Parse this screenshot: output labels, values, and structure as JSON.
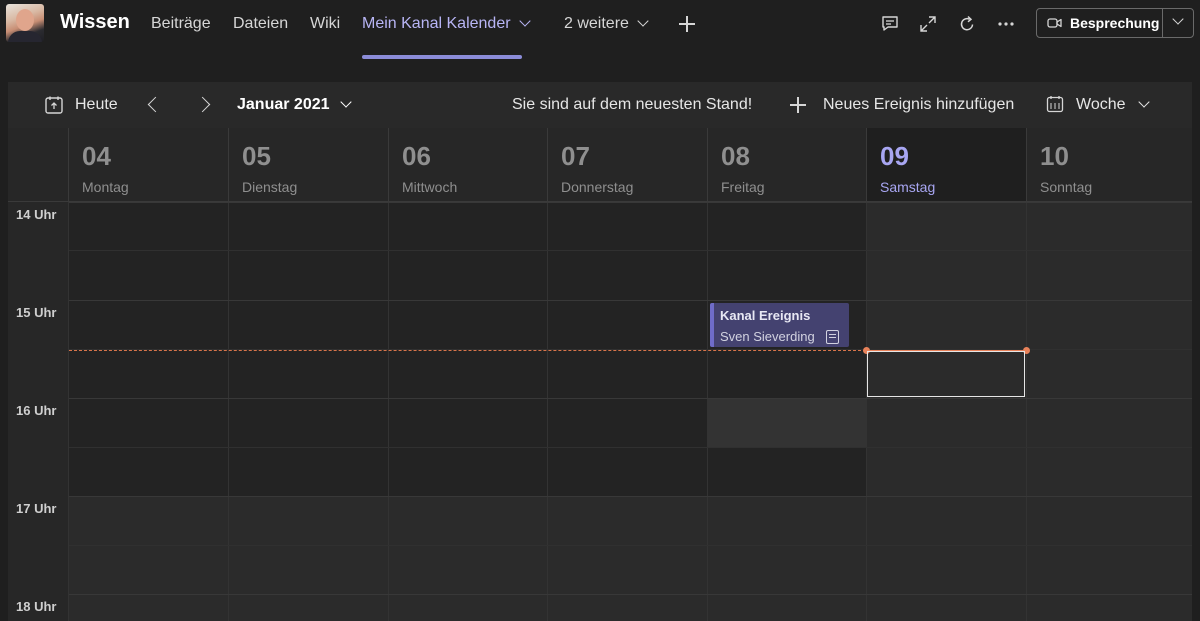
{
  "header": {
    "team_name": "Wissen",
    "tabs": [
      {
        "label": "Beiträge"
      },
      {
        "label": "Dateien"
      },
      {
        "label": "Wiki"
      },
      {
        "label": "Mein Kanal Kalender",
        "active": true
      },
      {
        "label": "2 weitere"
      }
    ],
    "meeting_button": "Besprechung"
  },
  "toolbar": {
    "today_label": "Heute",
    "month_label": "Januar 2021",
    "status": "Sie sind auf dem neuesten Stand!",
    "add_event_label": "Neues Ereignis hinzufügen",
    "view_label": "Woche"
  },
  "calendar": {
    "days": [
      {
        "num": "04",
        "name": "Montag"
      },
      {
        "num": "05",
        "name": "Dienstag"
      },
      {
        "num": "06",
        "name": "Mittwoch"
      },
      {
        "num": "07",
        "name": "Donnerstag"
      },
      {
        "num": "08",
        "name": "Freitag"
      },
      {
        "num": "09",
        "name": "Samstag",
        "today": true
      },
      {
        "num": "10",
        "name": "Sonntag"
      }
    ],
    "hours": [
      "14 Uhr",
      "15 Uhr",
      "16 Uhr",
      "17 Uhr",
      "18 Uhr"
    ],
    "event": {
      "title": "Kanal Ereignis",
      "organizer": "Sven Sieverding",
      "day": "08",
      "start": "15:00",
      "end": "15:30"
    }
  },
  "colors": {
    "accent": "#8b8cd8",
    "today_text": "#a8a6f2",
    "now_indicator": "#e8825a",
    "event_bg": "#444270"
  }
}
